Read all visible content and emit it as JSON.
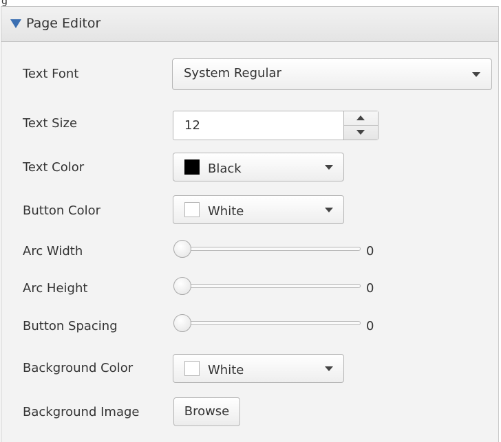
{
  "panel": {
    "title": "Page Editor",
    "top_fragment": "g"
  },
  "fields": {
    "text_font": {
      "label": "Text Font",
      "value": "System Regular"
    },
    "text_size": {
      "label": "Text Size",
      "value": "12"
    },
    "text_color": {
      "label": "Text Color",
      "value": "Black",
      "swatch": "#000000"
    },
    "button_color": {
      "label": "Button Color",
      "value": "White",
      "swatch": "#ffffff"
    },
    "arc_width": {
      "label": "Arc Width",
      "value": "0"
    },
    "arc_height": {
      "label": "Arc Height",
      "value": "0"
    },
    "button_spacing": {
      "label": "Button Spacing",
      "value": "0"
    },
    "background_color": {
      "label": "Background Color",
      "value": "White",
      "swatch": "#ffffff"
    },
    "background_image": {
      "label": "Background Image",
      "button": "Browse"
    }
  },
  "icons": {
    "header_toggle": "triangle-down-icon",
    "combo_caret": "chevron-down-icon",
    "spinner_up": "triangle-up-icon",
    "spinner_down": "triangle-down-icon"
  },
  "colors": {
    "accent": "#3b6fb2",
    "panel_background": "#f3f3f3",
    "border": "#b5b5b5"
  }
}
